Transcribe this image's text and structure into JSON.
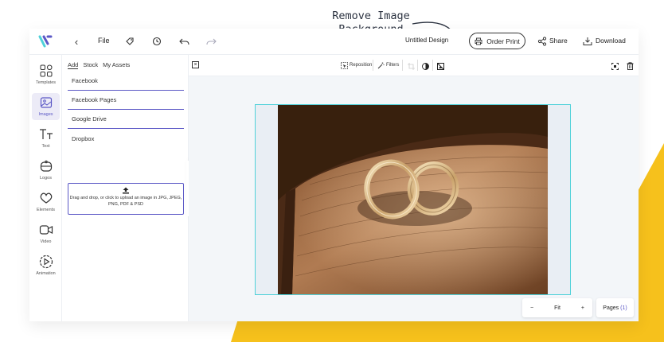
{
  "callout": {
    "line1": "Remove Image",
    "line2": "Background"
  },
  "topbar": {
    "file_label": "File",
    "doc_title": "Untitled Design",
    "order_print_label": "Order Print",
    "share_label": "Share",
    "download_label": "Download"
  },
  "rail": {
    "items": [
      {
        "label": "Templates",
        "icon": "grid-icon"
      },
      {
        "label": "Images",
        "icon": "image-icon",
        "active": true
      },
      {
        "label": "Text",
        "icon": "text-icon"
      },
      {
        "label": "Logos",
        "icon": "logo-icon"
      },
      {
        "label": "Elements",
        "icon": "heart-icon"
      },
      {
        "label": "Video",
        "icon": "video-icon"
      },
      {
        "label": "Animation",
        "icon": "play-icon"
      }
    ]
  },
  "panel": {
    "tabs": [
      {
        "label": "Add",
        "active": true
      },
      {
        "label": "Stock"
      },
      {
        "label": "My Assets"
      }
    ],
    "sources": [
      "Facebook",
      "Facebook Pages",
      "Google Drive",
      "Dropbox"
    ],
    "upload_text": "Drag and drop, or click to upload an image in JPG, JPEG, PNG, PDF & PSD"
  },
  "toolbar2": {
    "reposition_label": "Reposition",
    "filters_label": "Filters"
  },
  "zoom": {
    "minus": "−",
    "level": "Fit",
    "plus": "+"
  },
  "pages": {
    "label": "Pages",
    "count": "(1)"
  },
  "colors": {
    "accent": "#5b58c6",
    "canvas_border": "#4fd1d9",
    "yellow": "#f6c11c",
    "logo_primary": "#5b58c6",
    "logo_secondary": "#4fd1d9"
  }
}
